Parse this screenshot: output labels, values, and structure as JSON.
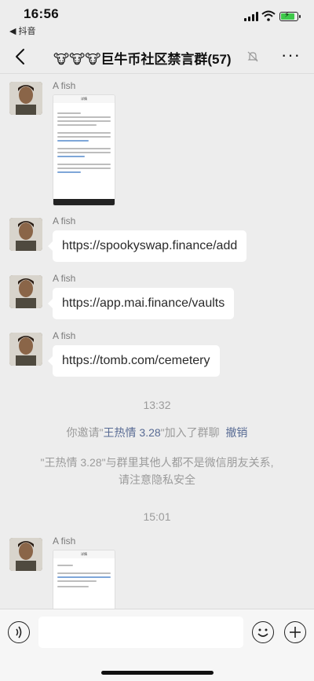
{
  "status": {
    "time": "16:56",
    "back_app": "◀ 抖音"
  },
  "nav": {
    "title": "🐮🐮🐮巨牛币社区禁言群(57)"
  },
  "messages": [
    {
      "type": "image",
      "sender": "A fish"
    },
    {
      "type": "text",
      "sender": "A fish",
      "text": "https://spookyswap.finance/add"
    },
    {
      "type": "text",
      "sender": "A fish",
      "text": "https://app.mai.finance/vaults"
    },
    {
      "type": "text",
      "sender": "A fish",
      "text": "https://tomb.com/cemetery"
    },
    {
      "type": "image",
      "sender": "A fish"
    }
  ],
  "timestamps": [
    "13:32",
    "15:01"
  ],
  "system": {
    "invite_prefix": "你邀请\"",
    "invitee": "王热情 3.28",
    "invite_suffix": "\"加入了群聊",
    "revoke": "撤销",
    "privacy_line1": "\"王热情 3.28\"与群里其他人都不是微信朋友关系,",
    "privacy_line2": "请注意隐私安全"
  },
  "screenshot_text": {
    "header": "详情"
  },
  "input": {
    "value": "",
    "placeholder": ""
  },
  "icons": [
    "back-icon",
    "mute-bell-icon",
    "more-icon",
    "voice-icon",
    "emoji-icon",
    "plus-icon",
    "signal-icon",
    "wifi-icon",
    "battery-icon"
  ],
  "colors": {
    "background": "#ededed",
    "bubble": "#ffffff",
    "link_blue": "#586b94",
    "system_gray": "#9b9b9b"
  }
}
